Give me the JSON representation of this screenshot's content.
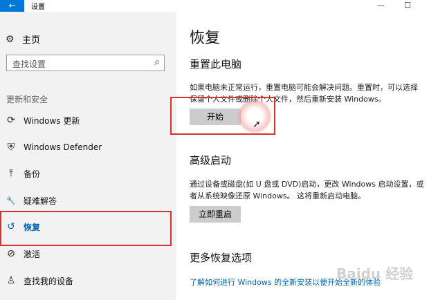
{
  "window": {
    "title": "设置",
    "back_glyph": "←",
    "min_glyph": "—",
    "max_glyph": "☐"
  },
  "sidebar": {
    "home_label": "主页",
    "search_placeholder": "查找设置",
    "section_title": "更新和安全",
    "items": [
      {
        "label": "Windows 更新",
        "icon": "sync-icon",
        "glyph": "⟳",
        "active": false
      },
      {
        "label": "Windows Defender",
        "icon": "shield-icon",
        "glyph": "⛨",
        "active": false
      },
      {
        "label": "备份",
        "icon": "backup-arrow-icon",
        "glyph": "⤒",
        "active": false
      },
      {
        "label": "疑难解答",
        "icon": "wrench-icon",
        "glyph": "🔧",
        "active": false
      },
      {
        "label": "恢复",
        "icon": "history-icon",
        "glyph": "↺",
        "active": true
      },
      {
        "label": "激活",
        "icon": "check-circle-icon",
        "glyph": "⊘",
        "active": false
      },
      {
        "label": "查找我的设备",
        "icon": "person-location-icon",
        "glyph": "♙",
        "active": false
      }
    ]
  },
  "main": {
    "title": "恢复",
    "reset": {
      "heading": "重置此电脑",
      "desc": "如果电脑未正常运行，重置电脑可能会解决问题。重置时，可以选择保留个人文件或删除个人文件，然后重新安装 Windows。",
      "button": "开始"
    },
    "advanced": {
      "heading": "高级启动",
      "desc": "通过设备或磁盘(如 U 盘或 DVD)启动，更改 Windows 启动设置，或者从系统映像还原 Windows。 这将重新启动电脑。",
      "button": "立即重启"
    },
    "more": {
      "heading": "更多恢复选项",
      "link": "了解如何进行 Windows 的全新安装以便开始全新的体验"
    }
  },
  "watermark": "Baidu 经验",
  "colors": {
    "accent": "#0078d7",
    "highlight_box": "#d9302c",
    "button_bg": "#cccccc",
    "link": "#0063b1"
  }
}
